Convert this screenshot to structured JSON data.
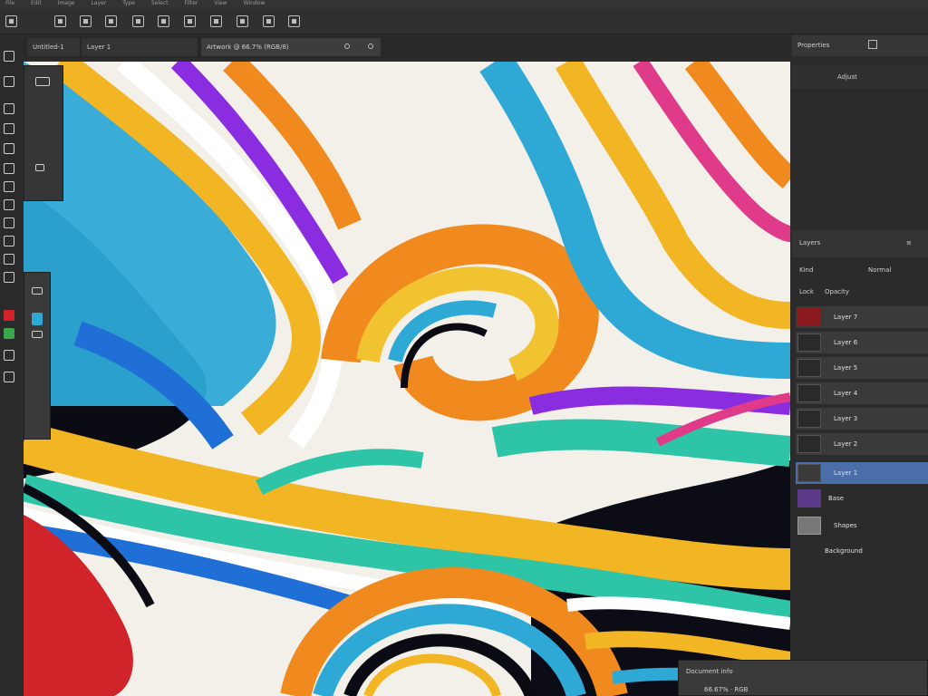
{
  "menubar": {
    "items": [
      "File",
      "Edit",
      "Image",
      "Layer",
      "Type",
      "Select",
      "Filter",
      "View",
      "Window"
    ]
  },
  "tabs": [
    {
      "label": "Untitled-1"
    },
    {
      "label": "Layer 1"
    },
    {
      "label": "Artwork @ 66.7% (RGB/8)"
    }
  ],
  "panels": {
    "properties": {
      "title": "Properties",
      "subtitle": "Adjust"
    },
    "layers": {
      "title": "Layers",
      "filter": "Kind",
      "blend": "Normal",
      "opacity": "Opacity",
      "lock": "Lock",
      "items": [
        {
          "label": "Layer 7"
        },
        {
          "label": "Layer 6"
        },
        {
          "label": "Layer 5"
        },
        {
          "label": "Layer 4"
        },
        {
          "label": "Layer 3"
        },
        {
          "label": "Layer 2"
        },
        {
          "label": "Layer 1"
        },
        {
          "label": "Base"
        },
        {
          "label": "Shapes"
        },
        {
          "label": "Background"
        }
      ]
    }
  },
  "status": {
    "title": "Document info",
    "detail": "66.67% · RGB"
  },
  "colors": {
    "accent": "#4b6ea8",
    "foreground": "#d0242a",
    "background": "#2ea9d6"
  }
}
